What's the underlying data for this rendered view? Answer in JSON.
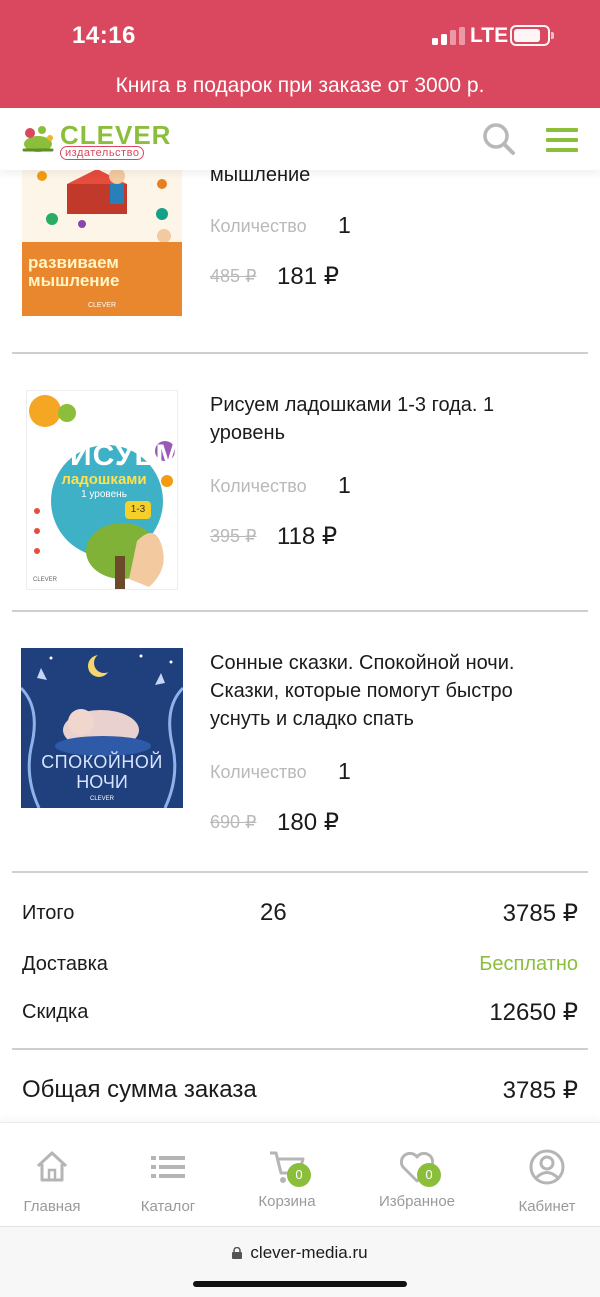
{
  "status_bar": {
    "time": "14:16",
    "network": "LTE"
  },
  "promo": {
    "text": "Книга в подарок при заказе от 3000 р."
  },
  "header": {
    "logo_text": "CLEVER",
    "logo_subtitle": "издательство"
  },
  "colors": {
    "brand_red": "#d9485e",
    "brand_green": "#8bbf3b",
    "muted_text": "#b9b9b9"
  },
  "products": [
    {
      "title": "мышление",
      "qty_label": "Количество",
      "qty": "1",
      "old_price": "485 ₽",
      "price": "181 ₽",
      "cover_text": "развиваем мышление",
      "cover_brand": "CLEVER"
    },
    {
      "title": "Рисуем ладошками 1-3 года. 1 уровень",
      "qty_label": "Количество",
      "qty": "1",
      "old_price": "395 ₽",
      "price": "118 ₽",
      "cover_text": "РИСУЕМ",
      "cover_text2": "ладошками",
      "cover_text3": "1 уровень",
      "cover_age": "1-3",
      "cover_brand": "CLEVER"
    },
    {
      "title": "Сонные сказки. Спокойной ночи. Сказки, которые помогут быстро уснуть и сладко спать",
      "qty_label": "Количество",
      "qty": "1",
      "old_price": "690 ₽",
      "price": "180 ₽",
      "cover_text": "СПОКОЙНОЙ",
      "cover_text2": "НОЧИ",
      "cover_brand": "CLEVER"
    }
  ],
  "summary": {
    "total_label": "Итого",
    "total_count": "26",
    "total_value": "3785 ₽",
    "delivery_label": "Доставка",
    "delivery_value": "Бесплатно",
    "discount_label": "Скидка",
    "discount_value": "12650 ₽",
    "order_total_label": "Общая сумма заказа",
    "order_total_value": "3785 ₽"
  },
  "nav": [
    {
      "label": "Главная",
      "icon": "home-icon"
    },
    {
      "label": "Каталог",
      "icon": "list-icon"
    },
    {
      "label": "Корзина",
      "icon": "cart-icon",
      "badge": "0"
    },
    {
      "label": "Избранное",
      "icon": "heart-icon",
      "badge": "0"
    },
    {
      "label": "Кабинет",
      "icon": "user-icon"
    }
  ],
  "browser": {
    "url": "clever-media.ru"
  }
}
